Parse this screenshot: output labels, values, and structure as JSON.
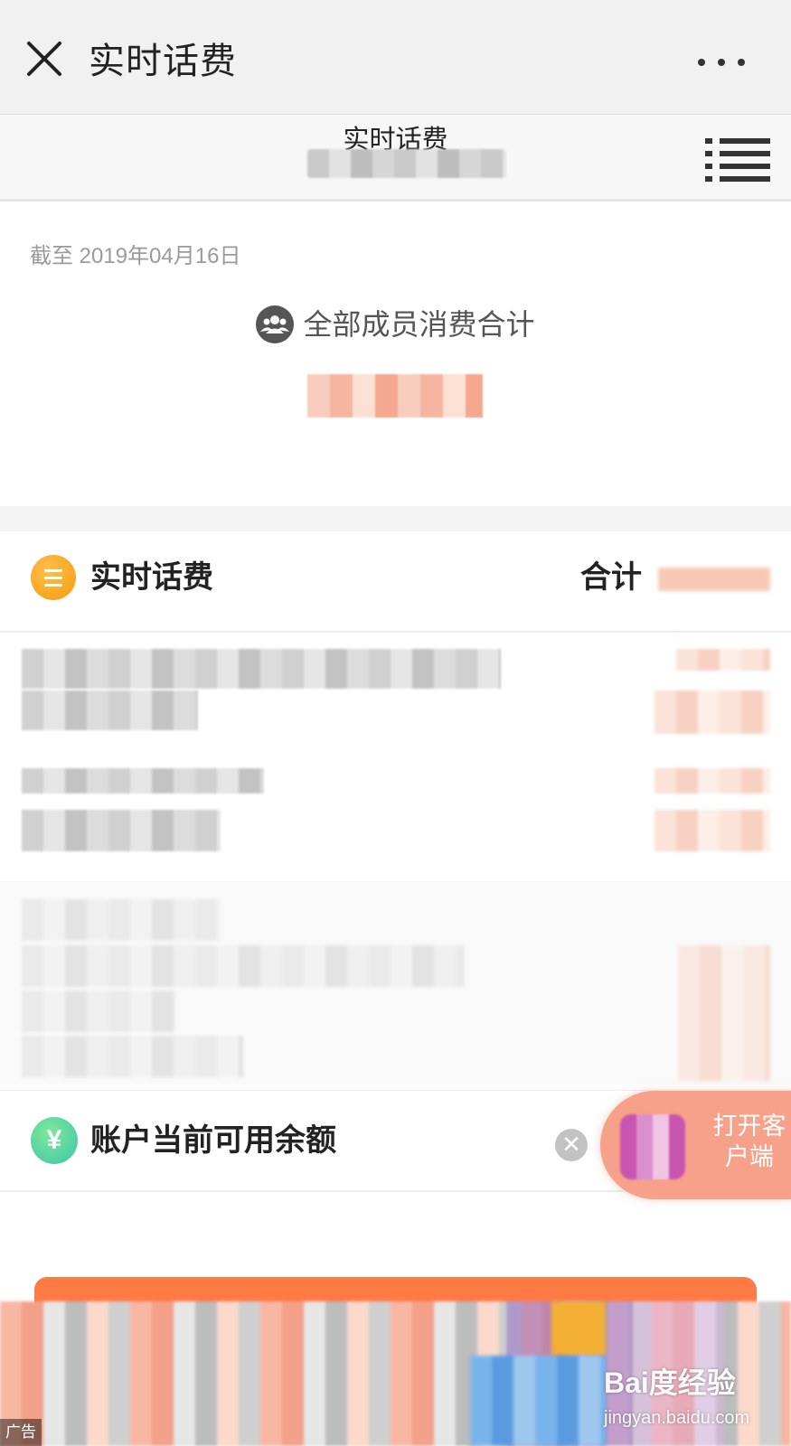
{
  "nav": {
    "title": "实时话费",
    "close_icon": "close-icon",
    "more_icon": "more-dots-icon"
  },
  "subheader": {
    "title": "实时话费",
    "list_icon": "list-icon"
  },
  "summary": {
    "as_of": "截至 2019年04月16日",
    "members_label": "全部成员消费合计",
    "members_icon": "group-icon"
  },
  "realtime": {
    "title": "实时话费",
    "total_label": "合计",
    "icon": "menu-list-icon"
  },
  "balance": {
    "label": "账户当前可用余额",
    "yuan_symbol": "¥",
    "icon": "yuan-icon"
  },
  "float_button": {
    "label": "打开客户端"
  },
  "ad": {
    "tag": "广告",
    "close_icon": "close-circle-icon"
  },
  "watermark": {
    "logo": "Bai度经验",
    "url": "jingyan.baidu.com"
  },
  "colors": {
    "accent_orange": "#f59a0c",
    "balance_green": "#3ec4a8",
    "float_pink": "#f7a08a",
    "ad_orange": "#ff7a45"
  }
}
